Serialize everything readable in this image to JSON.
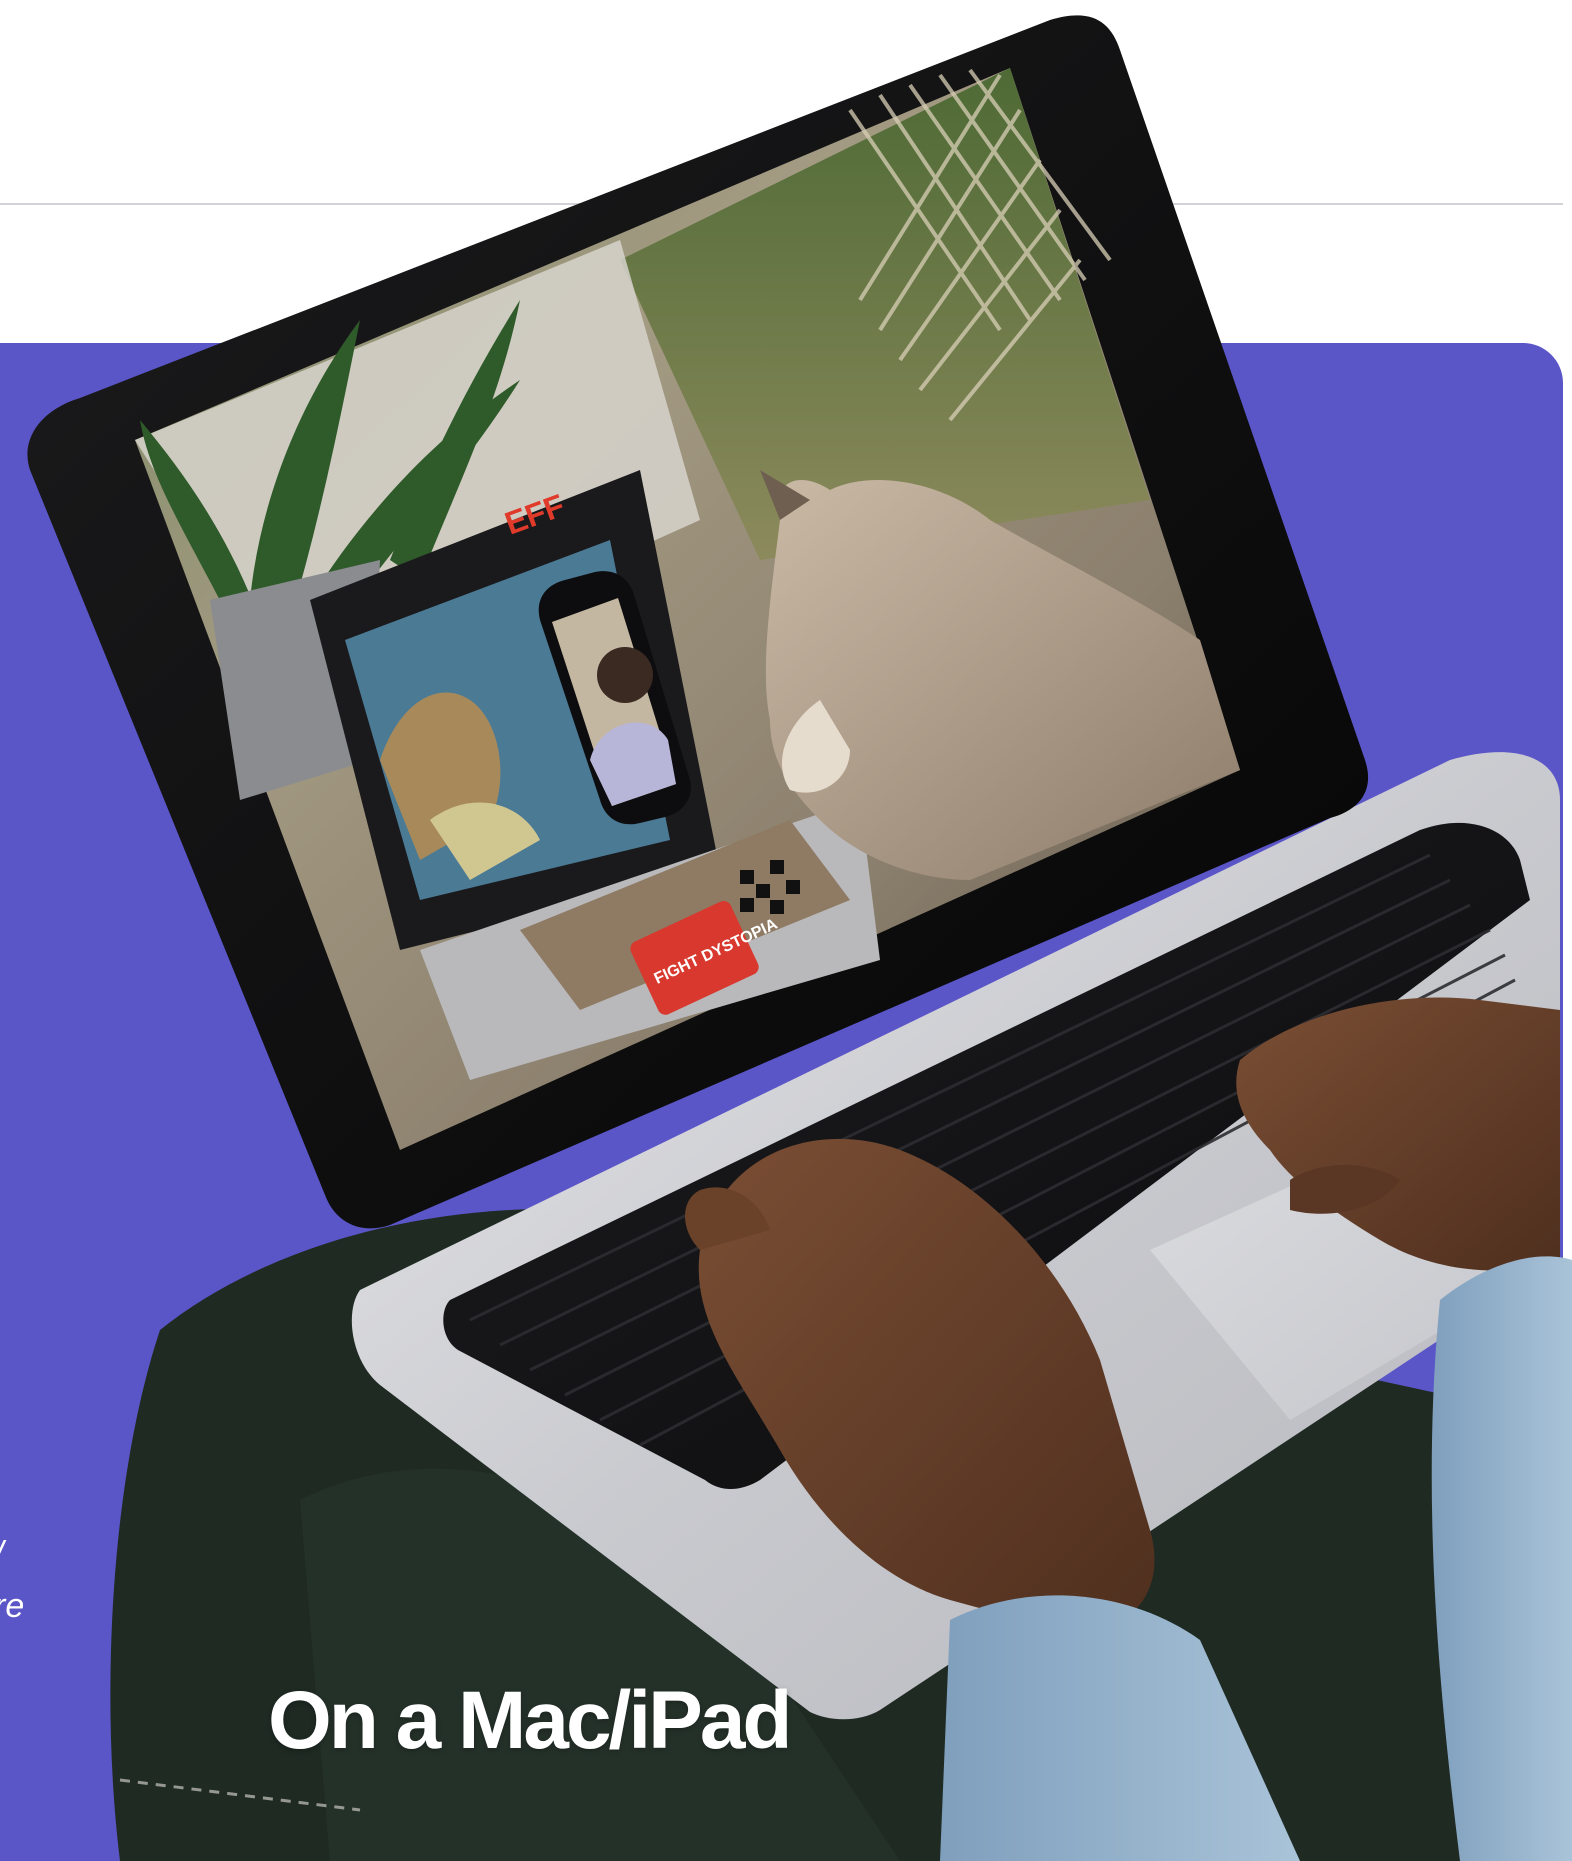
{
  "section": {
    "heading": "On a Mac/iPad",
    "intro_fragments": [
      "/",
      "re"
    ]
  },
  "photo": {
    "screen_logo": "EFF",
    "sticker_text": "FIGHT DYSTOPIA"
  },
  "colors": {
    "panel": "#5b56c8",
    "rule": "#d2d2d8",
    "heading": "#ffffff"
  }
}
